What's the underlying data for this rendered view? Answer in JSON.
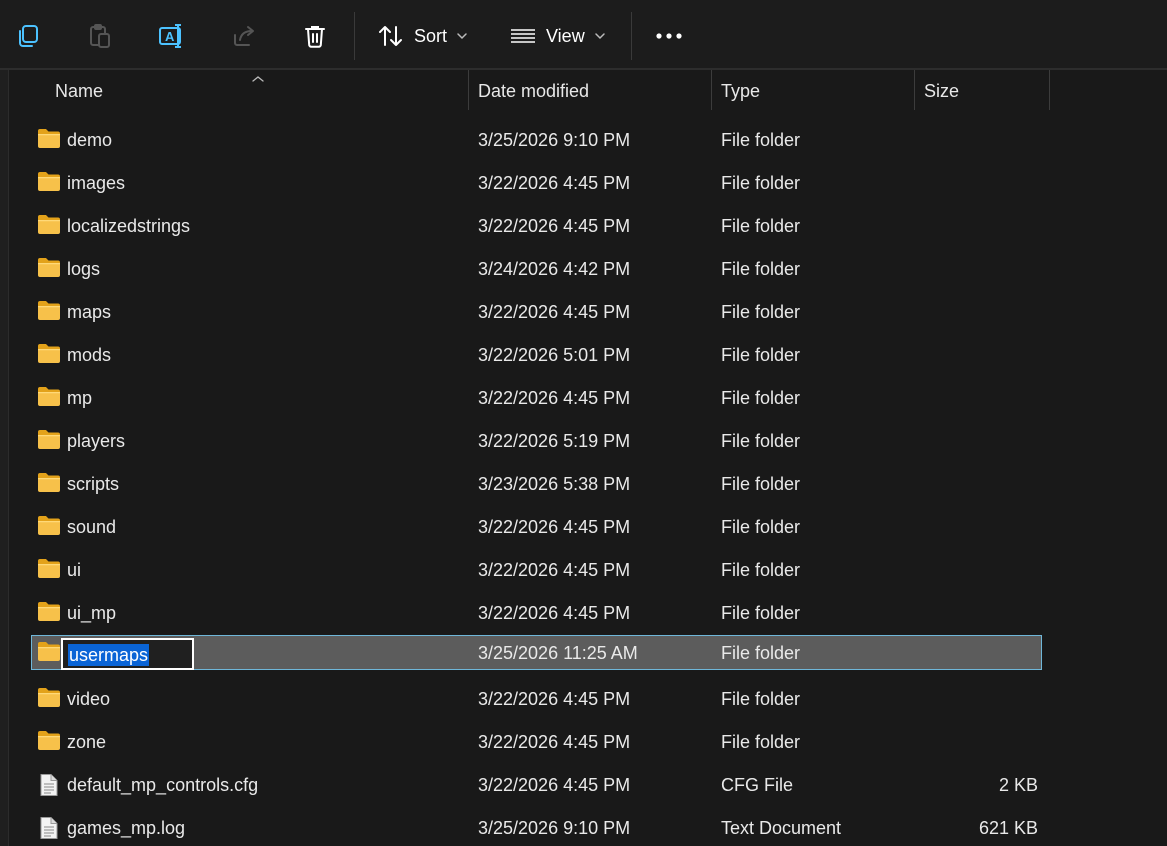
{
  "toolbar": {
    "sort_label": "Sort",
    "view_label": "View"
  },
  "columns": {
    "name": "Name",
    "date": "Date modified",
    "type": "Type",
    "size": "Size"
  },
  "rows": [
    {
      "name": "demo",
      "date": "3/25/2026 9:10 PM",
      "type": "File folder",
      "size": "",
      "icon": "folder-icon"
    },
    {
      "name": "images",
      "date": "3/22/2026 4:45 PM",
      "type": "File folder",
      "size": "",
      "icon": "folder-icon"
    },
    {
      "name": "localizedstrings",
      "date": "3/22/2026 4:45 PM",
      "type": "File folder",
      "size": "",
      "icon": "folder-icon"
    },
    {
      "name": "logs",
      "date": "3/24/2026 4:42 PM",
      "type": "File folder",
      "size": "",
      "icon": "folder-icon"
    },
    {
      "name": "maps",
      "date": "3/22/2026 4:45 PM",
      "type": "File folder",
      "size": "",
      "icon": "folder-icon"
    },
    {
      "name": "mods",
      "date": "3/22/2026 5:01 PM",
      "type": "File folder",
      "size": "",
      "icon": "folder-icon"
    },
    {
      "name": "mp",
      "date": "3/22/2026 4:45 PM",
      "type": "File folder",
      "size": "",
      "icon": "folder-icon"
    },
    {
      "name": "players",
      "date": "3/22/2026 5:19 PM",
      "type": "File folder",
      "size": "",
      "icon": "folder-icon"
    },
    {
      "name": "scripts",
      "date": "3/23/2026 5:38 PM",
      "type": "File folder",
      "size": "",
      "icon": "folder-icon"
    },
    {
      "name": "sound",
      "date": "3/22/2026 4:45 PM",
      "type": "File folder",
      "size": "",
      "icon": "folder-icon"
    },
    {
      "name": "ui",
      "date": "3/22/2026 4:45 PM",
      "type": "File folder",
      "size": "",
      "icon": "folder-icon"
    },
    {
      "name": "ui_mp",
      "date": "3/22/2026 4:45 PM",
      "type": "File folder",
      "size": "",
      "icon": "folder-icon"
    },
    {
      "name": "usermaps",
      "date": "3/25/2026 11:25 AM",
      "type": "File folder",
      "size": "",
      "icon": "folder-icon",
      "selected": true,
      "renaming": true
    },
    {
      "name": "video",
      "date": "3/22/2026 4:45 PM",
      "type": "File folder",
      "size": "",
      "icon": "folder-icon"
    },
    {
      "name": "zone",
      "date": "3/22/2026 4:45 PM",
      "type": "File folder",
      "size": "",
      "icon": "folder-icon"
    },
    {
      "name": "default_mp_controls.cfg",
      "date": "3/22/2026 4:45 PM",
      "type": "CFG File",
      "size": "2 KB",
      "icon": "file-icon"
    },
    {
      "name": "games_mp.log",
      "date": "3/25/2026 9:10 PM",
      "type": "Text Document",
      "size": "621 KB",
      "icon": "file-icon"
    }
  ],
  "colors": {
    "accent": "#4cc2ff",
    "selection_bg": "#5c5c5c",
    "selection_border": "#6fb7d9",
    "rename_highlight": "#0a64d6",
    "folder": "#f7c14a"
  }
}
